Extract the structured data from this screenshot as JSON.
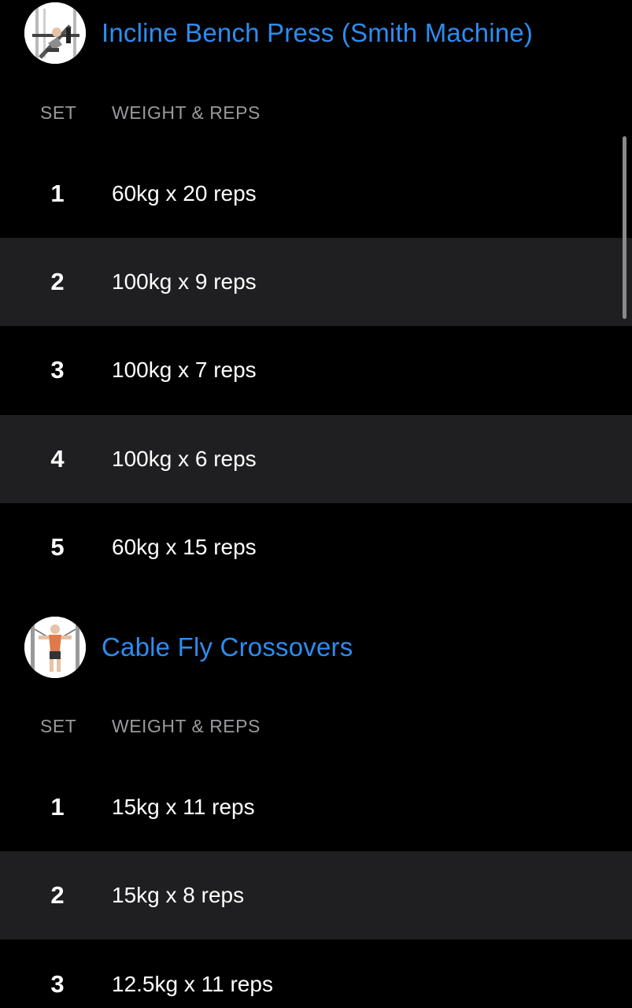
{
  "colors": {
    "title": "#2d8cf0",
    "header_text": "#9a9a9e",
    "row_shade": "#1f1f21",
    "text": "#ffffff"
  },
  "exercises": [
    {
      "title": "Incline Bench Press (Smith Machine)",
      "thumbnail_icon": "incline-bench-press-illustration",
      "columns": {
        "set": "SET",
        "weight_reps": "WEIGHT & REPS"
      },
      "sets": [
        {
          "num": "1",
          "value": "60kg x 20 reps"
        },
        {
          "num": "2",
          "value": "100kg x 9 reps"
        },
        {
          "num": "3",
          "value": "100kg x 7 reps"
        },
        {
          "num": "4",
          "value": "100kg x 6 reps"
        },
        {
          "num": "5",
          "value": "60kg x 15 reps"
        }
      ]
    },
    {
      "title": "Cable Fly Crossovers",
      "thumbnail_icon": "cable-fly-illustration",
      "columns": {
        "set": "SET",
        "weight_reps": "WEIGHT & REPS"
      },
      "sets": [
        {
          "num": "1",
          "value": "15kg x 11 reps"
        },
        {
          "num": "2",
          "value": "15kg x 8 reps"
        },
        {
          "num": "3",
          "value": "12.5kg x 11 reps"
        }
      ]
    }
  ]
}
